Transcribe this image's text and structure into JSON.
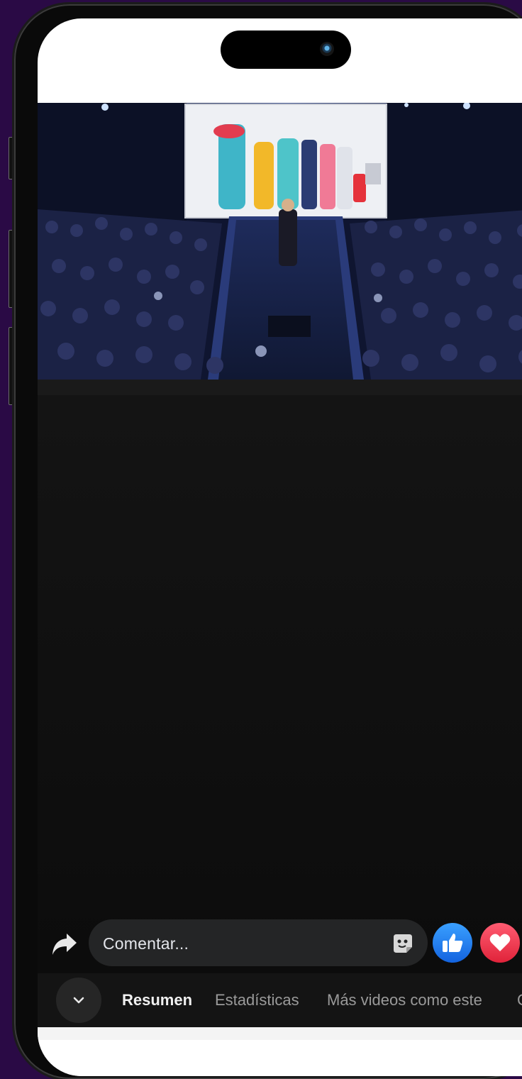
{
  "comment_bar": {
    "placeholder": "Comentar..."
  },
  "reactions": [
    "like",
    "love",
    "more"
  ],
  "tabs": {
    "items": [
      "Resumen",
      "Estadísticas",
      "Más videos como este",
      "Co"
    ]
  },
  "icons": {
    "share": "share-icon",
    "sticker": "sticker-icon",
    "collapse": "chevron-down-icon"
  },
  "colors": {
    "like": "#1877f2",
    "love": "#f33e58",
    "comment_bg": "#242526"
  }
}
